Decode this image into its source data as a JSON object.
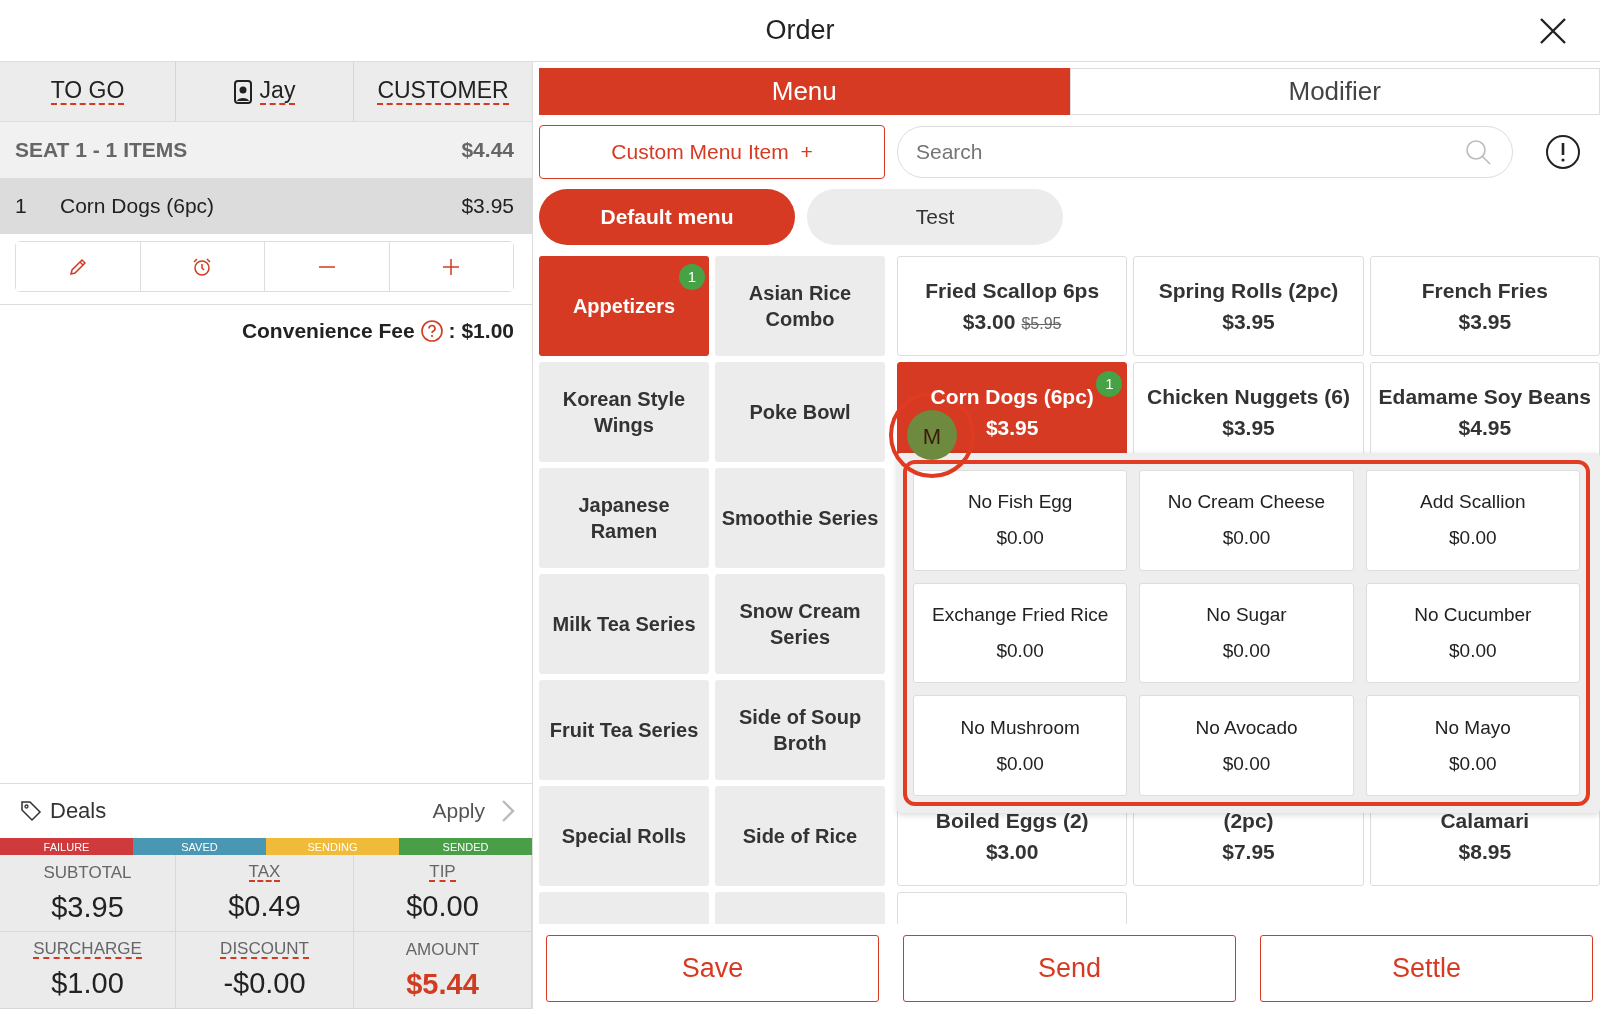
{
  "window": {
    "title": "Order"
  },
  "order_tabs": [
    {
      "label": "TO GO",
      "kind": "plain"
    },
    {
      "label": "Jay",
      "kind": "staff"
    },
    {
      "label": "CUSTOMER",
      "kind": "plain"
    }
  ],
  "seat": {
    "label": "SEAT 1 - 1 ITEMS",
    "total": "$4.44"
  },
  "order_items": [
    {
      "qty": "1",
      "name": "Corn Dogs (6pc)",
      "price": "$3.95",
      "selected": true
    }
  ],
  "convenience_fee": {
    "label": "Convenience Fee",
    "value": ": $1.00"
  },
  "deals": {
    "label": "Deals",
    "action": "Apply"
  },
  "status_legend": [
    {
      "label": "FAILURE",
      "color": "#cf3b3c"
    },
    {
      "label": "SAVED",
      "color": "#4a97b3"
    },
    {
      "label": "SENDING",
      "color": "#f0bb3b"
    },
    {
      "label": "SENDED",
      "color": "#4b9e48"
    }
  ],
  "totals": [
    {
      "label": "SUBTOTAL",
      "value": "$3.95",
      "underlined": false,
      "emphasis": false
    },
    {
      "label": "TAX",
      "value": "$0.49",
      "underlined": true,
      "emphasis": false
    },
    {
      "label": "TIP",
      "value": "$0.00",
      "underlined": true,
      "emphasis": false
    },
    {
      "label": "SURCHARGE",
      "value": "$1.00",
      "underlined": true,
      "emphasis": false
    },
    {
      "label": "DISCOUNT",
      "value": "-$0.00",
      "underlined": true,
      "emphasis": false
    },
    {
      "label": "AMOUNT",
      "value": "$5.44",
      "underlined": false,
      "emphasis": true
    }
  ],
  "panel_tabs": [
    {
      "label": "Menu",
      "selected": true
    },
    {
      "label": "Modifier",
      "selected": false
    }
  ],
  "custom_item_button": {
    "label": "Custom Menu Item",
    "icon": "+"
  },
  "search": {
    "placeholder": "Search"
  },
  "menus": [
    {
      "label": "Default menu",
      "selected": true
    },
    {
      "label": "Test",
      "selected": false
    }
  ],
  "categories": [
    {
      "name": "Appetizers",
      "selected": true,
      "badge": "1"
    },
    {
      "name": "Asian Rice Combo",
      "selected": false
    },
    {
      "name": "Korean Style Wings",
      "selected": false
    },
    {
      "name": "Poke Bowl",
      "selected": false
    },
    {
      "name": "Japanese Ramen",
      "selected": false
    },
    {
      "name": "Smoothie Series",
      "selected": false
    },
    {
      "name": "Milk Tea Series",
      "selected": false
    },
    {
      "name": "Snow Cream Series",
      "selected": false
    },
    {
      "name": "Fruit Tea Series",
      "selected": false
    },
    {
      "name": "Side of Soup Broth",
      "selected": false
    },
    {
      "name": "Special Rolls",
      "selected": false
    },
    {
      "name": "Side of Rice",
      "selected": false
    },
    {
      "selected": false
    },
    {
      "selected": false
    }
  ],
  "items": [
    {
      "name": "Fried Scallop 6ps",
      "price": "$3.00",
      "old_price": "$5.95",
      "selected": false
    },
    {
      "name": "Spring Rolls (2pc)",
      "price": "$3.95",
      "selected": false
    },
    {
      "name": "French Fries",
      "price": "$3.95",
      "selected": false
    },
    {
      "name": "Corn Dogs (6pc)",
      "price": "$3.95",
      "selected": true,
      "badge": "1"
    },
    {
      "name": "Chicken Nuggets (6)",
      "price": "$3.95",
      "selected": false
    },
    {
      "name": "Edamame Soy Beans",
      "price": "$4.95",
      "selected": false
    }
  ],
  "items_below_popup": [
    {
      "name": "Boiled Eggs (2)",
      "price": "$3.00"
    },
    {
      "name": "(2pc)",
      "price": "$7.95"
    },
    {
      "name": "Calamari",
      "price": "$8.95"
    }
  ],
  "drag_avatar": {
    "label": "M"
  },
  "modifiers": [
    {
      "name": "No Fish Egg",
      "price": "$0.00"
    },
    {
      "name": "No Cream Cheese",
      "price": "$0.00"
    },
    {
      "name": "Add Scallion",
      "price": "$0.00"
    },
    {
      "name": "Exchange Fried Rice",
      "price": "$0.00"
    },
    {
      "name": "No Sugar",
      "price": "$0.00"
    },
    {
      "name": "No Cucumber",
      "price": "$0.00"
    },
    {
      "name": "No Mushroom",
      "price": "$0.00"
    },
    {
      "name": "No Avocado",
      "price": "$0.00"
    },
    {
      "name": "No Mayo",
      "price": "$0.00"
    }
  ],
  "actions": [
    "Save",
    "Send",
    "Settle"
  ]
}
